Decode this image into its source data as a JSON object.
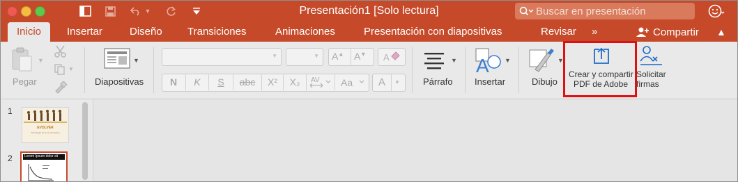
{
  "title_bar": {
    "document_title": "Presentación1 [Solo lectura]",
    "search_placeholder": "Buscar en presentación"
  },
  "tabs": [
    {
      "label": "Inicio",
      "active": true
    },
    {
      "label": "Insertar"
    },
    {
      "label": "Diseño"
    },
    {
      "label": "Transiciones"
    },
    {
      "label": "Animaciones"
    },
    {
      "label": "Presentación con diapositivas"
    },
    {
      "label": "Revisar"
    },
    {
      "label": "»"
    }
  ],
  "share_label": "Compartir",
  "ribbon": {
    "paste_label": "Pegar",
    "slides_label": "Diapositivas",
    "format_buttons": [
      "N",
      "K",
      "S",
      "abc",
      "X²",
      "X₂"
    ],
    "paragraph_label": "Párrafo",
    "insert_label": "Insertar",
    "draw_label": "Dibujo",
    "adobe_line1": "Crear y compartir",
    "adobe_line2": "PDF de Adobe",
    "sign_line1": "Solicitar",
    "sign_line2": "firmas"
  },
  "slides": [
    {
      "number": "1",
      "title": "EVOLVER",
      "subtitle": "Tecnología de la comunicación"
    },
    {
      "number": "2",
      "title": "Lorem Ipsum dolor sit"
    }
  ],
  "colors": {
    "accent": "#c64a29",
    "ribbon_bg": "#e9e9e9",
    "highlight": "#e11010"
  }
}
